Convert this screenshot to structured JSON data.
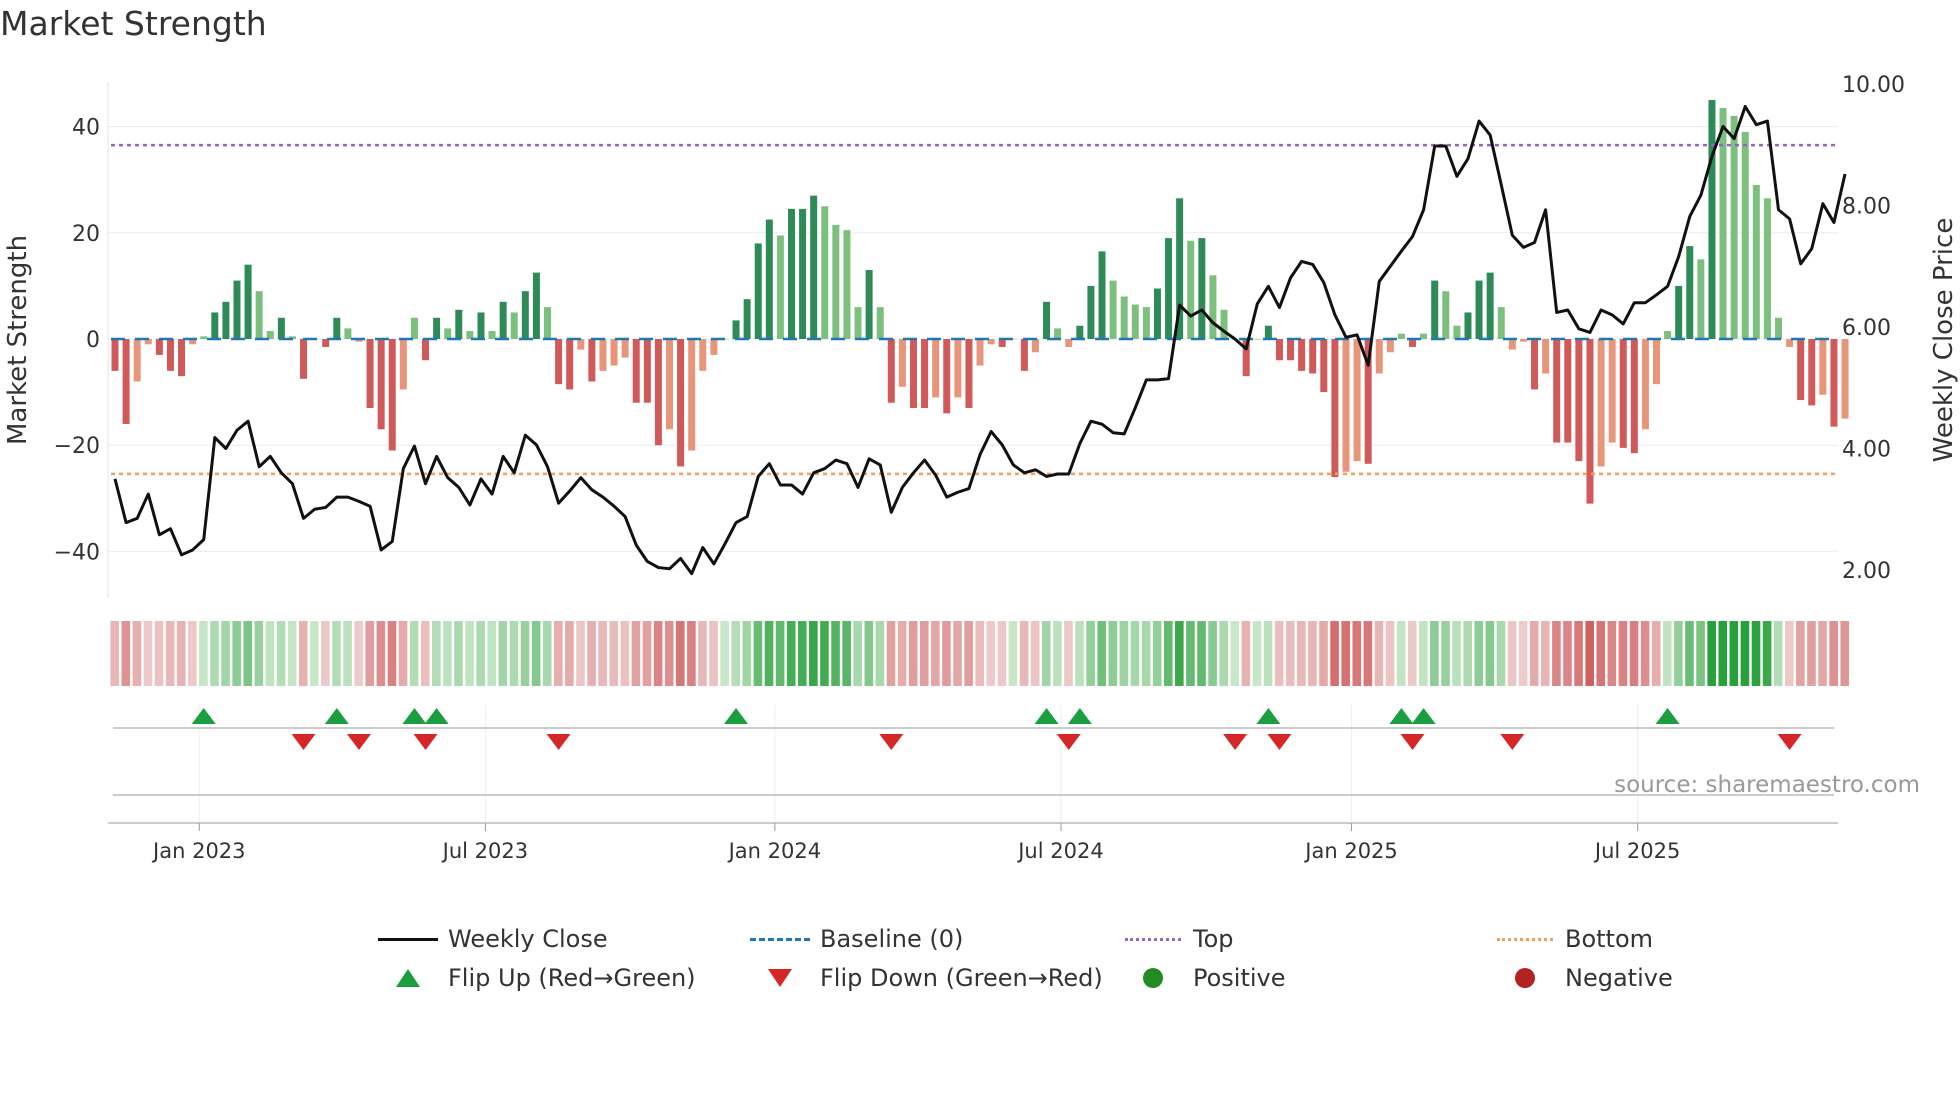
{
  "title": "Market Strength",
  "source": "source: sharemaestro.com",
  "legend": {
    "weekly_close": "Weekly Close",
    "baseline": "Baseline (0)",
    "top": "Top",
    "bottom": "Bottom",
    "flip_up": "Flip Up (Red→Green)",
    "flip_down": "Flip Down (Green→Red)",
    "positive": "Positive",
    "negative": "Negative"
  },
  "colors": {
    "pos_dark": "#2e8b57",
    "pos_light": "#7dbf7d",
    "neg_dark": "#d05a5a",
    "neg_light": "#e8967a",
    "line": "#111111",
    "baseline": "#1f77b4",
    "top": "#9467bd",
    "bottom": "#f4a05a",
    "flip_up": "#1a9e3f",
    "flip_down": "#d62728",
    "positive": "#228b22",
    "negative": "#b22222"
  },
  "chart_data": {
    "type": "bar+line",
    "title": "Market Strength",
    "ylabel": "Market Strength",
    "y2label": "Weekly Close Price",
    "ylim": [
      -49,
      48
    ],
    "y2lim": [
      1.3,
      10.3
    ],
    "yticks": [
      "40",
      "20",
      "0",
      "−20",
      "−40"
    ],
    "ytick_values": [
      40,
      20,
      0,
      -20,
      -40
    ],
    "y2ticks": [
      "10.00",
      "8.00",
      "6.00",
      "4.00",
      "2.00"
    ],
    "y2tick_values": [
      10,
      8,
      6,
      4,
      2
    ],
    "top_level": 36.5,
    "bottom_level": -25.4,
    "baseline": 0,
    "xticks": [
      {
        "label": "Jan 2023",
        "week": 7.6
      },
      {
        "label": "Jul 2023",
        "week": 33.4
      },
      {
        "label": "Jan 2024",
        "week": 59.5
      },
      {
        "label": "Jul 2024",
        "week": 85.3
      },
      {
        "label": "Jan 2025",
        "week": 111.5
      },
      {
        "label": "Jul 2025",
        "week": 137.3
      }
    ],
    "strength": [
      -6,
      -16,
      -8,
      -1,
      -3,
      -6,
      -7,
      -1,
      0.5,
      5,
      7,
      11,
      14,
      9,
      1.5,
      4,
      0.5,
      -7.5,
      0,
      -1.5,
      4,
      2,
      -0.5,
      -13,
      -17,
      -21,
      -9.5,
      4,
      -4,
      4,
      2,
      5.5,
      1.5,
      5,
      1.5,
      7,
      5,
      9,
      12.5,
      6,
      -8.5,
      -9.5,
      -2,
      -8,
      -6,
      -5,
      -3.5,
      -12,
      -12,
      -20,
      -17,
      -24,
      -21,
      -6,
      -3,
      0,
      3.5,
      7.5,
      18,
      22.5,
      19.5,
      24.5,
      24.5,
      27,
      25,
      21.5,
      20.5,
      6,
      13,
      6,
      -12,
      -9,
      -13,
      -13,
      -11,
      -14,
      -11,
      -13,
      -5,
      -1,
      -1.5,
      0,
      -6,
      -2.5,
      7,
      2,
      -1.5,
      2.5,
      10,
      16.5,
      11,
      8,
      6.5,
      6,
      9.5,
      19,
      26.5,
      18.5,
      19,
      12,
      5.5,
      0,
      -7,
      0,
      2.5,
      -4,
      -4,
      -6,
      -6.5,
      -10,
      -26,
      -25,
      -23,
      -23.5,
      -6.5,
      -2.5,
      1,
      -1.5,
      1,
      11,
      9,
      2.5,
      5,
      11,
      12.5,
      6,
      -2,
      -0.5,
      -9.5,
      -6.5,
      -19.5,
      -19.5,
      -23,
      -31,
      -24,
      -19.5,
      -20.5,
      -21.5,
      -17,
      -8.5,
      1.5,
      10,
      17.5,
      15,
      45,
      43.5,
      42,
      39,
      29,
      26.5,
      4,
      -1.5,
      -11.5,
      -12.5,
      -10.5,
      -16.5,
      -15
    ],
    "close": [
      3.5,
      2.78,
      2.85,
      3.25,
      2.58,
      2.68,
      2.25,
      2.33,
      2.5,
      4.18,
      4.0,
      4.3,
      4.45,
      3.7,
      3.87,
      3.6,
      3.42,
      2.85,
      3.0,
      3.03,
      3.2,
      3.2,
      3.13,
      3.05,
      2.33,
      2.47,
      3.67,
      4.04,
      3.42,
      3.87,
      3.52,
      3.36,
      3.07,
      3.5,
      3.25,
      3.87,
      3.6,
      4.22,
      4.06,
      3.7,
      3.1,
      3.3,
      3.52,
      3.32,
      3.2,
      3.05,
      2.88,
      2.41,
      2.14,
      2.04,
      2.02,
      2.19,
      1.94,
      2.37,
      2.1,
      2.43,
      2.78,
      2.88,
      3.54,
      3.75,
      3.4,
      3.4,
      3.25,
      3.6,
      3.67,
      3.81,
      3.75,
      3.36,
      3.83,
      3.73,
      2.95,
      3.36,
      3.6,
      3.81,
      3.56,
      3.2,
      3.28,
      3.34,
      3.9,
      4.28,
      4.06,
      3.73,
      3.6,
      3.65,
      3.54,
      3.58,
      3.58,
      4.08,
      4.45,
      4.4,
      4.26,
      4.24,
      4.67,
      5.13,
      5.13,
      5.15,
      6.36,
      6.18,
      6.28,
      6.07,
      5.93,
      5.8,
      5.64,
      6.38,
      6.67,
      6.32,
      6.81,
      7.08,
      7.03,
      6.73,
      6.2,
      5.83,
      5.87,
      5.37,
      6.75,
      7.0,
      7.25,
      7.49,
      7.93,
      8.98,
      8.98,
      8.48,
      8.77,
      9.39,
      9.16,
      8.34,
      7.51,
      7.31,
      7.39,
      7.93,
      6.24,
      6.28,
      5.97,
      5.91,
      6.28,
      6.2,
      6.05,
      6.4,
      6.4,
      6.53,
      6.67,
      7.16,
      7.82,
      8.17,
      8.81,
      9.3,
      9.1,
      9.63,
      9.33,
      9.39,
      7.93,
      7.78,
      7.04,
      7.29,
      8.03,
      7.72,
      8.52
    ],
    "flip_up_weeks": [
      8,
      20,
      27,
      29,
      56,
      84,
      87,
      104,
      116,
      118,
      140
    ],
    "flip_down_weeks": [
      17,
      22,
      28,
      40,
      70,
      86,
      101,
      105,
      117,
      126,
      151
    ],
    "legend_position": "bottom"
  }
}
